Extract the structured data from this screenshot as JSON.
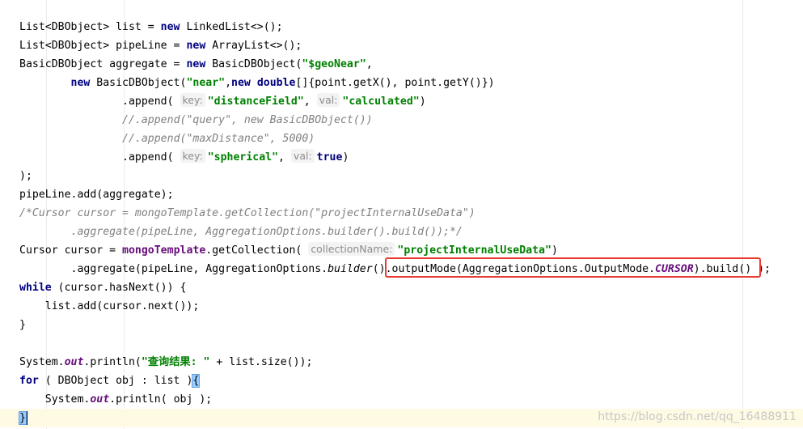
{
  "editor": {
    "language": "Java",
    "current_line_bg": "#fffae3",
    "highlight_color": "#e83a2f",
    "lines": [
      {
        "tokens": [
          {
            "t": "List<DBObject> list = "
          },
          {
            "t": "new",
            "c": "kw"
          },
          {
            "t": " LinkedList<>();"
          }
        ]
      },
      {
        "tokens": [
          {
            "t": "List<DBObject> pipeLine = "
          },
          {
            "t": "new",
            "c": "kw"
          },
          {
            "t": " ArrayList<>();"
          }
        ]
      },
      {
        "tokens": [
          {
            "t": "BasicDBObject aggregate = "
          },
          {
            "t": "new",
            "c": "kw"
          },
          {
            "t": " BasicDBObject("
          },
          {
            "t": "\"$geoNear\"",
            "c": "str"
          },
          {
            "t": ","
          }
        ]
      },
      {
        "tokens": [
          {
            "t": "        "
          },
          {
            "t": "new",
            "c": "kw"
          },
          {
            "t": " BasicDBObject("
          },
          {
            "t": "\"near\"",
            "c": "str"
          },
          {
            "t": ","
          },
          {
            "t": "new",
            "c": "kw"
          },
          {
            "t": " "
          },
          {
            "t": "double",
            "c": "kw"
          },
          {
            "t": "[]{point.getX(), point.getY()})"
          }
        ]
      },
      {
        "tokens": [
          {
            "t": "                .append( "
          },
          {
            "t": "key:",
            "c": "hint"
          },
          {
            "t": "\"distanceField\"",
            "c": "str"
          },
          {
            "t": ", "
          },
          {
            "t": "val:",
            "c": "hint"
          },
          {
            "t": "\"calculated\"",
            "c": "str"
          },
          {
            "t": ")"
          }
        ]
      },
      {
        "tokens": [
          {
            "t": "                "
          },
          {
            "t": "//.append(\"query\", new BasicDBObject())",
            "c": "cmt"
          }
        ]
      },
      {
        "tokens": [
          {
            "t": "                "
          },
          {
            "t": "//.append(\"maxDistance\", 5000)",
            "c": "cmt"
          }
        ]
      },
      {
        "tokens": [
          {
            "t": "                .append( "
          },
          {
            "t": "key:",
            "c": "hint"
          },
          {
            "t": "\"spherical\"",
            "c": "str"
          },
          {
            "t": ", "
          },
          {
            "t": "val:",
            "c": "hint"
          },
          {
            "t": "true",
            "c": "kw"
          },
          {
            "t": ")"
          }
        ]
      },
      {
        "tokens": [
          {
            "t": ");"
          }
        ]
      },
      {
        "tokens": [
          {
            "t": "pipeLine.add(aggregate);"
          }
        ]
      },
      {
        "tokens": [
          {
            "t": "/*Cursor cursor = mongoTemplate.getCollection(\"projectInternalUseData\")",
            "c": "cmt"
          }
        ]
      },
      {
        "tokens": [
          {
            "t": "        .aggregate(pipeLine, AggregationOptions.builder().build());*/",
            "c": "cmt"
          }
        ]
      },
      {
        "tokens": [
          {
            "t": "Cursor cursor = "
          },
          {
            "t": "mongoTemplate",
            "c": "field"
          },
          {
            "t": ".getCollection( "
          },
          {
            "t": "collectionName:",
            "c": "hint"
          },
          {
            "t": "\"projectInternalUseData\"",
            "c": "str"
          },
          {
            "t": ")"
          }
        ]
      },
      {
        "tokens": [
          {
            "t": "        .aggregate(pipeLine, AggregationOptions."
          },
          {
            "t": "builder",
            "c": "static-m"
          },
          {
            "t": "().outputMode(AggregationOptions.OutputMode."
          },
          {
            "t": "CURSOR",
            "c": "static-f"
          },
          {
            "t": ").build() );"
          }
        ]
      },
      {
        "tokens": [
          {
            "t": "while",
            "c": "kw"
          },
          {
            "t": " (cursor.hasNext()) {"
          }
        ]
      },
      {
        "tokens": [
          {
            "t": "    list.add(cursor.next());"
          }
        ]
      },
      {
        "tokens": [
          {
            "t": "}"
          }
        ]
      },
      {
        "tokens": [
          {
            "t": ""
          }
        ]
      },
      {
        "tokens": [
          {
            "t": "System."
          },
          {
            "t": "out",
            "c": "static-f"
          },
          {
            "t": ".println("
          },
          {
            "t": "\"查询结果: \"",
            "c": "str"
          },
          {
            "t": " + list.size());"
          }
        ]
      },
      {
        "tokens": [
          {
            "t": "for",
            "c": "kw"
          },
          {
            "t": " ( DBObject obj : list )"
          },
          {
            "t": "{",
            "c": "brace-match"
          }
        ]
      },
      {
        "tokens": [
          {
            "t": "    System."
          },
          {
            "t": "out",
            "c": "static-f"
          },
          {
            "t": ".println( obj );"
          }
        ]
      },
      {
        "tokens": [
          {
            "t": "}",
            "c": "brace-match"
          }
        ],
        "current": true,
        "caret": true
      }
    ]
  },
  "watermark": "https://blog.csdn.net/qq_16488911"
}
